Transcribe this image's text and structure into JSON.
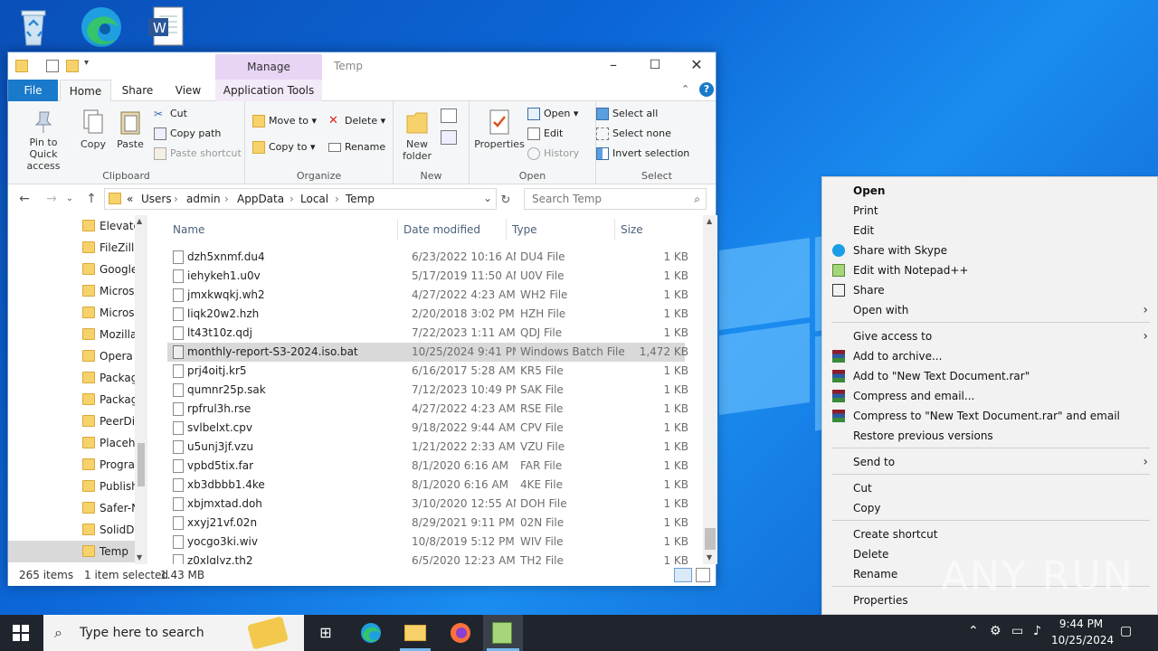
{
  "desktop": {
    "icons": [
      "recycle-bin",
      "edge",
      "word-document"
    ]
  },
  "window": {
    "title": "Temp",
    "contextual_tab": "Manage",
    "controls": {
      "minimize": "–",
      "maximize": "☐",
      "close": "✕"
    }
  },
  "ribbon_tabs": [
    "File",
    "Home",
    "Share",
    "View",
    "Application Tools"
  ],
  "ribbon": {
    "clipboard": {
      "label": "Clipboard",
      "pin": "Pin to Quick access",
      "copy": "Copy",
      "paste": "Paste",
      "cut": "Cut",
      "copy_path": "Copy path",
      "paste_shortcut": "Paste shortcut"
    },
    "organize": {
      "label": "Organize",
      "move_to": "Move to",
      "copy_to": "Copy to",
      "delete": "Delete",
      "rename": "Rename"
    },
    "new": {
      "label": "New",
      "new_folder": "New folder"
    },
    "open": {
      "label": "Open",
      "properties": "Properties",
      "open": "Open",
      "edit": "Edit",
      "history": "History"
    },
    "select": {
      "label": "Select",
      "select_all": "Select all",
      "select_none": "Select none",
      "invert": "Invert selection"
    }
  },
  "address": {
    "prefix": "«",
    "crumbs": [
      "Users",
      "admin",
      "AppData",
      "Local",
      "Temp"
    ],
    "search_placeholder": "Search Temp"
  },
  "nav_pane": {
    "items": [
      "Elevate",
      "FileZilla",
      "Google",
      "Microsc",
      "Microsc",
      "Mozilla",
      "Opera",
      "Packag",
      "Packag",
      "PeerDis",
      "Placeho",
      "Progran",
      "Publish",
      "Safer-N",
      "SolidDc",
      "Temp"
    ],
    "selected": "Temp"
  },
  "columns": {
    "name": "Name",
    "date": "Date modified",
    "type": "Type",
    "size": "Size"
  },
  "files": [
    {
      "name": "dzh5xnmf.du4",
      "date": "6/23/2022 10:16 AM",
      "type": "DU4 File",
      "size": "1 KB"
    },
    {
      "name": "iehykeh1.u0v",
      "date": "5/17/2019 11:50 AM",
      "type": "U0V File",
      "size": "1 KB"
    },
    {
      "name": "jmxkwqkj.wh2",
      "date": "4/27/2022 4:23 AM",
      "type": "WH2 File",
      "size": "1 KB"
    },
    {
      "name": "liqk20w2.hzh",
      "date": "2/20/2018 3:02 PM",
      "type": "HZH File",
      "size": "1 KB"
    },
    {
      "name": "lt43t10z.qdj",
      "date": "7/22/2023 1:11 AM",
      "type": "QDJ File",
      "size": "1 KB"
    },
    {
      "name": "monthly-report-S3-2024.iso.bat",
      "date": "10/25/2024 9:41 PM",
      "type": "Windows Batch File",
      "size": "1,472 KB",
      "selected": true
    },
    {
      "name": "prj4oitj.kr5",
      "date": "6/16/2017 5:28 AM",
      "type": "KR5 File",
      "size": "1 KB"
    },
    {
      "name": "qumnr25p.sak",
      "date": "7/12/2023 10:49 PM",
      "type": "SAK File",
      "size": "1 KB"
    },
    {
      "name": "rpfrul3h.rse",
      "date": "4/27/2022 4:23 AM",
      "type": "RSE File",
      "size": "1 KB"
    },
    {
      "name": "svlbelxt.cpv",
      "date": "9/18/2022 9:44 AM",
      "type": "CPV File",
      "size": "1 KB"
    },
    {
      "name": "u5unj3jf.vzu",
      "date": "1/21/2022 2:33 AM",
      "type": "VZU File",
      "size": "1 KB"
    },
    {
      "name": "vpbd5tix.far",
      "date": "8/1/2020 6:16 AM",
      "type": "FAR File",
      "size": "1 KB"
    },
    {
      "name": "xb3dbbb1.4ke",
      "date": "8/1/2020 6:16 AM",
      "type": "4KE File",
      "size": "1 KB"
    },
    {
      "name": "xbjmxtad.doh",
      "date": "3/10/2020 12:55 AM",
      "type": "DOH File",
      "size": "1 KB"
    },
    {
      "name": "xxyj21vf.02n",
      "date": "8/29/2021 9:11 PM",
      "type": "02N File",
      "size": "1 KB"
    },
    {
      "name": "yocgo3ki.wiv",
      "date": "10/8/2019 5:12 PM",
      "type": "WIV File",
      "size": "1 KB"
    },
    {
      "name": "z0xlqlyz.th2",
      "date": "6/5/2020 12:23 AM",
      "type": "TH2 File",
      "size": "1 KB"
    }
  ],
  "status": {
    "count": "265 items",
    "selection": "1 item selected",
    "size": "1.43 MB"
  },
  "context_menu": {
    "open": "Open",
    "print": "Print",
    "edit": "Edit",
    "share_skype": "Share with Skype",
    "edit_notepadpp": "Edit with Notepad++",
    "share": "Share",
    "open_with": "Open with",
    "give_access": "Give access to",
    "add_archive": "Add to archive...",
    "add_rar": "Add to \"New Text Document.rar\"",
    "compress_email": "Compress and email...",
    "compress_rar_email": "Compress to \"New Text Document.rar\" and email",
    "restore": "Restore previous versions",
    "send_to": "Send to",
    "cut": "Cut",
    "copy": "Copy",
    "create_shortcut": "Create shortcut",
    "delete": "Delete",
    "rename": "Rename",
    "properties": "Properties"
  },
  "taskbar": {
    "search_placeholder": "Type here to search",
    "time": "9:44 PM",
    "date": "10/25/2024"
  },
  "watermark": "ANY RUN",
  "colors": {
    "accent": "#1979ca",
    "selection": "#d9d9d9",
    "taskbar": "#20252d",
    "manage_tab": "#e8d5f5"
  }
}
